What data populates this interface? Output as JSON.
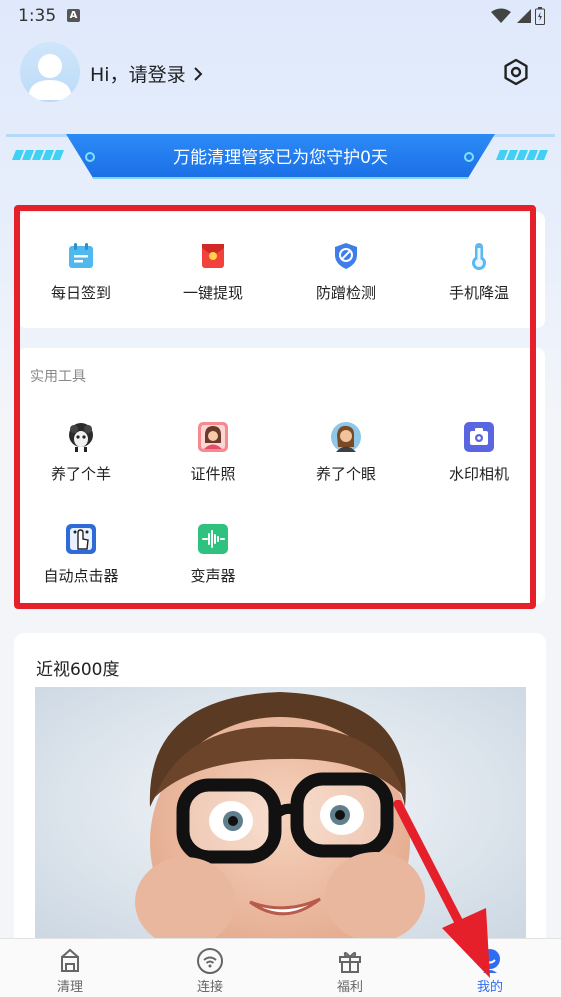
{
  "status_bar": {
    "time": "1:35",
    "notification_letter": "A"
  },
  "header": {
    "greeting": "Hi，请登录"
  },
  "banner": {
    "text": "万能清理管家已为您守护0天"
  },
  "quick_actions": [
    {
      "label": "每日签到",
      "icon": "calendar-check-icon"
    },
    {
      "label": "一键提现",
      "icon": "red-envelope-icon"
    },
    {
      "label": "防蹭检测",
      "icon": "shield-icon"
    },
    {
      "label": "手机降温",
      "icon": "thermometer-icon"
    }
  ],
  "tools": {
    "title": "实用工具",
    "items": [
      {
        "label": "养了个羊",
        "icon": "sheep-icon"
      },
      {
        "label": "证件照",
        "icon": "id-photo-icon"
      },
      {
        "label": "养了个眼",
        "icon": "eye-care-icon"
      },
      {
        "label": "水印相机",
        "icon": "camera-icon"
      },
      {
        "label": "自动点击器",
        "icon": "auto-clicker-icon"
      },
      {
        "label": "变声器",
        "icon": "voice-changer-icon"
      }
    ]
  },
  "article": {
    "title": "近视600度"
  },
  "bottom_nav": [
    {
      "label": "清理",
      "icon": "clean-icon",
      "active": false
    },
    {
      "label": "连接",
      "icon": "wifi-icon",
      "active": false
    },
    {
      "label": "福利",
      "icon": "gift-icon",
      "active": false
    },
    {
      "label": "我的",
      "icon": "profile-icon",
      "active": true
    }
  ],
  "colors": {
    "accent": "#2f6cf6",
    "highlight_frame": "#e6202a",
    "banner": "#1f7af0"
  }
}
